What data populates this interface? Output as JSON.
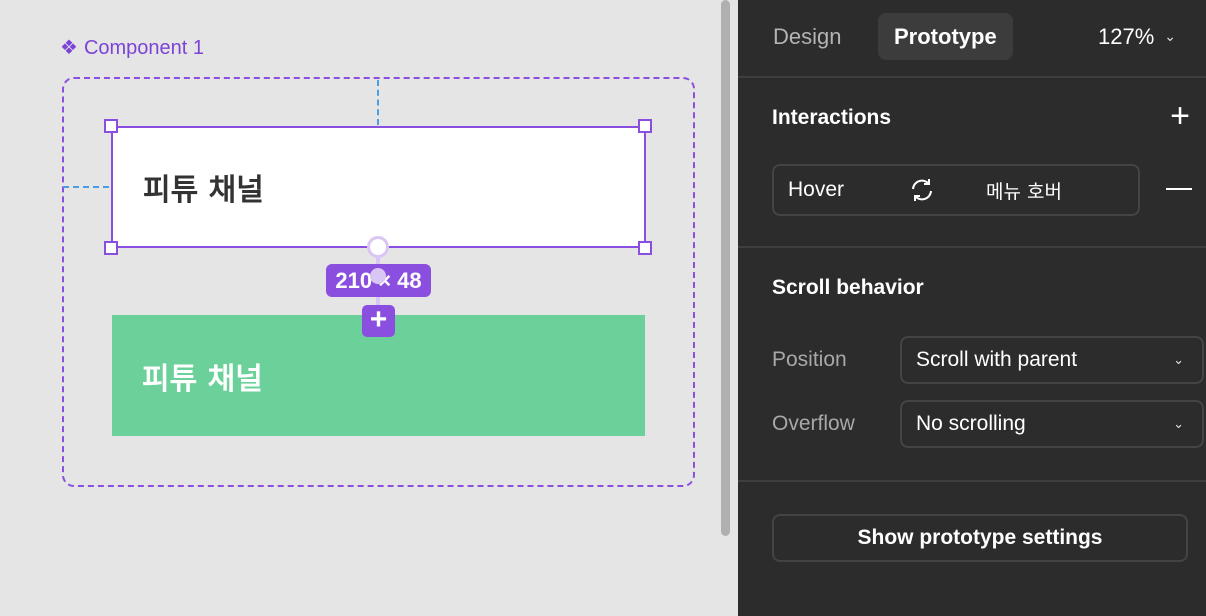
{
  "canvas": {
    "component_label": "Component 1",
    "variant_default_text": "피튜 채널",
    "variant_hover_text": "피튜 채널",
    "size_badge": "210 × 48",
    "add_symbol": "+",
    "colors": {
      "selection": "#8b4fe0",
      "guide": "#4a9ee8",
      "hover_fill": "#6bd09a",
      "canvas_bg": "#e5e5e5"
    }
  },
  "panel": {
    "tabs": [
      {
        "label": "Design",
        "active": false
      },
      {
        "label": "Prototype",
        "active": true
      }
    ],
    "zoom": "127%",
    "interactions": {
      "title": "Interactions",
      "add_icon": "plus-icon",
      "items": [
        {
          "trigger": "Hover",
          "icon": "cycle-icon",
          "destination": "메뉴 호버",
          "remove_icon": "minus-icon"
        }
      ]
    },
    "scroll_behavior": {
      "title": "Scroll behavior",
      "position_label": "Position",
      "position_value": "Scroll with parent",
      "overflow_label": "Overflow",
      "overflow_value": "No scrolling"
    },
    "settings_button": "Show prototype settings",
    "colors": {
      "panel_bg": "#2c2c2c",
      "tab_active_bg": "#3c3c3c",
      "border": "#444444"
    }
  }
}
